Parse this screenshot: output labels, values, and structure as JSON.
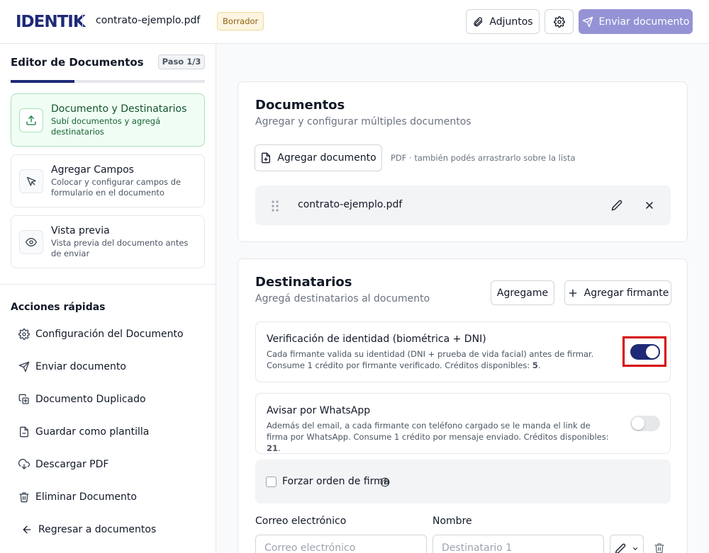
{
  "header": {
    "logo": "IDENTIK",
    "filename": "contrato-ejemplo.pdf",
    "status_badge": "Borrador",
    "adjuntos_label": "Adjuntos",
    "send_label": "Enviar documento"
  },
  "sidebar": {
    "title": "Editor de Documentos",
    "step_indicator": "Paso 1/3",
    "progress_fraction": 0.33,
    "steps": [
      {
        "title": "Documento y Destinatarios",
        "desc": "Subí documentos y agregá destinatarios",
        "icon": "upload-icon",
        "active": true
      },
      {
        "title": "Agregar Campos",
        "desc": "Colocar y configurar campos de formulario en el documento",
        "icon": "cursor-icon",
        "active": false
      },
      {
        "title": "Vista previa",
        "desc": "Vista previa del documento antes de enviar",
        "icon": "eye-icon",
        "active": false
      }
    ],
    "quick_actions_title": "Acciones rápidas",
    "quick_actions": [
      {
        "label": "Configuración del Documento",
        "icon": "gear-icon"
      },
      {
        "label": "Enviar documento",
        "icon": "send-icon"
      },
      {
        "label": "Documento Duplicado",
        "icon": "duplicate-icon"
      },
      {
        "label": "Guardar como plantilla",
        "icon": "template-icon"
      },
      {
        "label": "Descargar PDF",
        "icon": "cloud-download-icon"
      },
      {
        "label": "Eliminar Documento",
        "icon": "trash-icon"
      }
    ],
    "back_label": "Regresar a documentos"
  },
  "documents": {
    "title": "Documentos",
    "subtitle": "Agregar y configurar múltiples documentos",
    "add_button": "Agregar documento",
    "hint": "PDF · también podés arrastrarlo sobre la lista",
    "files": [
      {
        "name": "contrato-ejemplo.pdf"
      }
    ]
  },
  "recipients": {
    "title": "Destinatarios",
    "subtitle": "Agregá destinatarios al documento",
    "add_me_button": "Agregame",
    "add_signer_button": "Agregar firmante",
    "identity": {
      "title": "Verificación de identidad (biométrica + DNI)",
      "desc": "Cada firmante valida su identidad (DNI + prueba de vida facial) antes de firmar. Consume 1 crédito por firmante verificado. Créditos disponibles: ",
      "credits": "5",
      "enabled": true
    },
    "whatsapp": {
      "title": "Avisar por WhatsApp",
      "desc": "Además del email, a cada firmante con teléfono cargado se le manda el link de firma por WhatsApp. Consume 1 crédito por mensaje enviado. Créditos disponibles: ",
      "credits": "21",
      "enabled": false
    },
    "order_label": "Forzar orden de firma",
    "order_checked": false,
    "email_label": "Correo electrónico",
    "email_placeholder": "Correo electrónico",
    "name_label": "Nombre",
    "name_placeholder": "Destinatario 1"
  },
  "colors": {
    "brand": "#1e2a78",
    "send_button": "#9593d6",
    "active_step_bg": "#f0fdf4",
    "highlight_border": "#d60000"
  }
}
